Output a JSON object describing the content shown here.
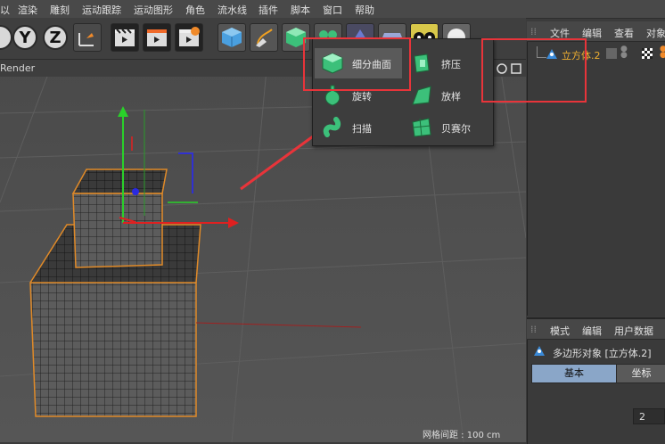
{
  "menu": [
    "以",
    "渲染",
    "雕刻",
    "运动跟踪",
    "运动图形",
    "角色",
    "流水线",
    "插件",
    "脚本",
    "窗口",
    "帮助"
  ],
  "toolbar": {
    "axis_y": "Y",
    "axis_z": "Z"
  },
  "viewport": {
    "header_label": "Render",
    "grid_spacing": "网格间距 : 100 cm"
  },
  "popup": {
    "items": [
      {
        "label": "细分曲面",
        "icon": "subdivision-surface-icon"
      },
      {
        "label": "挤压",
        "icon": "extrude-icon"
      },
      {
        "label": "旋转",
        "icon": "lathe-icon"
      },
      {
        "label": "放样",
        "icon": "loft-icon"
      },
      {
        "label": "扫描",
        "icon": "sweep-icon"
      },
      {
        "label": "贝赛尔",
        "icon": "bezier-icon"
      }
    ]
  },
  "object_manager": {
    "tabs": [
      "文件",
      "编辑",
      "查看",
      "对象"
    ],
    "object_name": "立方体.2"
  },
  "attribute_manager": {
    "tabs": [
      "模式",
      "编辑",
      "用户数据"
    ],
    "object_title": "多边形对象 [立方体.2]",
    "tab_basic": "基本",
    "tab_coord": "坐标",
    "field_value": "2"
  },
  "colors": {
    "accent_red": "#e8343a",
    "active_tab": "#8aa6c8",
    "object_name_color": "#f0b030",
    "green_icon": "#3cc07a"
  }
}
